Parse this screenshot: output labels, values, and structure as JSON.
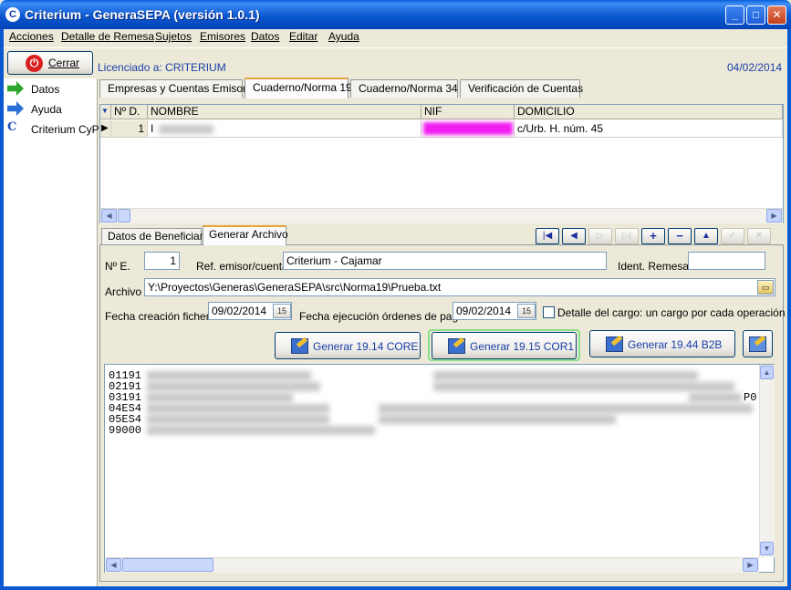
{
  "window": {
    "title": "Criterium - GeneraSEPA (versión 1.0.1)",
    "icon": "app-logo-icon",
    "controls": [
      "minimize-icon",
      "maximize-icon",
      "close-icon"
    ]
  },
  "menu": [
    {
      "label": "Acciones",
      "underline": "A"
    },
    {
      "label": "Detalle de Remesa",
      "underline": "D"
    },
    {
      "label": "Sujetos",
      "underline": "S"
    },
    {
      "label": "Emisores",
      "underline": "E"
    },
    {
      "label": "Datos",
      "underline": "D"
    },
    {
      "label": "Editar",
      "underline": "i"
    },
    {
      "label": "Ayuda",
      "underline": "A"
    }
  ],
  "toolbar": {
    "close_label": "Cerrar",
    "license": "Licenciado a: CRITERIUM",
    "date": "04/02/2014"
  },
  "sidebar": {
    "items": [
      {
        "label": "Datos",
        "icon": "green-arrow-icon"
      },
      {
        "label": "Ayuda",
        "icon": "blue-arrow-icon"
      },
      {
        "label": "Criterium CyP",
        "icon": "criterium-cyp-icon"
      }
    ]
  },
  "tabs": [
    {
      "label": "Empresas y Cuentas Emisoras",
      "active": false
    },
    {
      "label": "Cuaderno/Norma 19",
      "active": true
    },
    {
      "label": "Cuaderno/Norma 34",
      "active": false
    },
    {
      "label": "Verificación de Cuentas",
      "active": false
    }
  ],
  "grid": {
    "columns": [
      "Nº D.",
      "NOMBRE",
      "NIF",
      "DOMICILIO"
    ],
    "rows": [
      {
        "num": "1",
        "nombre": "I",
        "nif": "",
        "domicilio": "c/Urb. H. núm. 45"
      }
    ]
  },
  "subtabs": [
    {
      "label": "Datos de Beneficiario",
      "active": false
    },
    {
      "label": "Generar Archivo",
      "active": true
    }
  ],
  "nav_buttons": [
    "first-record-icon",
    "prior-record-icon",
    "next-record-icon",
    "last-record-icon",
    "insert-icon",
    "delete-icon",
    "edit-icon",
    "post-icon",
    "cancel-icon"
  ],
  "form": {
    "ne_label": "Nº E.",
    "ne_value": "1",
    "ref_label": "Ref. emisor/cuenta",
    "ref_value": "Criterium - Cajamar",
    "ident_label": "Ident. Remesa",
    "ident_value": "",
    "archivo_label": "Archivo",
    "archivo_value": "Y:\\Proyectos\\Generas\\GeneraSEPA\\src\\Norma19\\Prueba.txt",
    "fecha_creacion_label": "Fecha creación fichero",
    "fecha_creacion_value": "09/02/2014",
    "fecha_ejecucion_label": "Fecha ejecución órdenes de pago",
    "fecha_ejecucion_value": "09/02/2014",
    "detalle_label": "Detalle del cargo: un cargo por cada operación",
    "detalle_checked": false
  },
  "buttons": {
    "core": "Generar 19.14 CORE",
    "cor1": "Generar 19.15 COR1",
    "b2b": "Generar 19.44 B2B"
  },
  "output": {
    "lines": [
      "01191",
      "02191",
      "03191",
      "04ES4",
      "05ES4",
      "99000"
    ],
    "tail": "P0"
  },
  "colors": {
    "titlebar": "#0b58d0",
    "link_text": "#1b3fa8",
    "active_tab_accent": "#e8a33c",
    "highlight_glow": "#88e088"
  }
}
